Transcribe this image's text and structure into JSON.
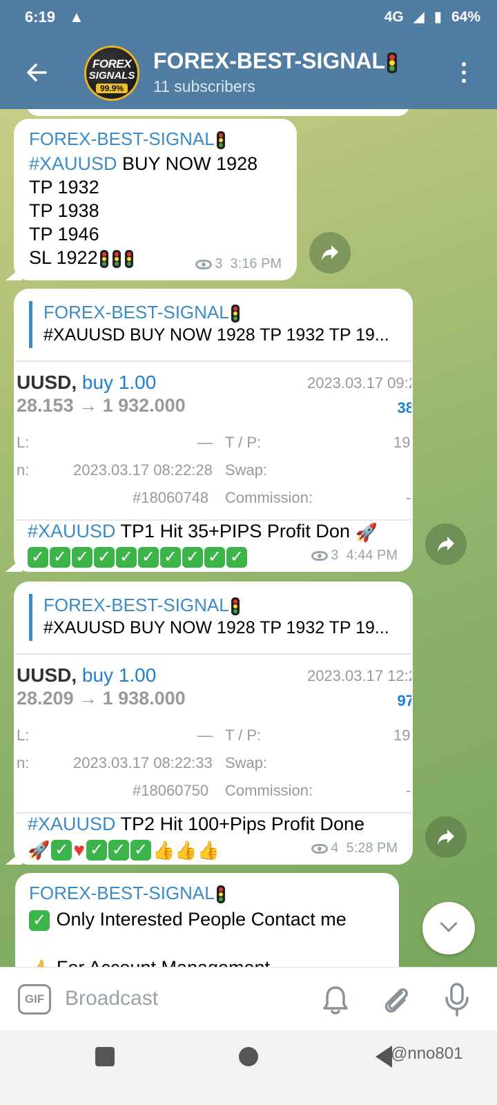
{
  "status_bar": {
    "time": "6:19",
    "warning": "▲",
    "network": "4G",
    "battery": "64%"
  },
  "header": {
    "back_icon": "arrow-left-icon",
    "avatar": {
      "line1": "FOREX",
      "line2": "SIGNALS",
      "line3": "99.9%"
    },
    "title": "FOREX-BEST-SIGNAL",
    "subtitle": "11 subscribers"
  },
  "messages": [
    {
      "sender": "FOREX-BEST-SIGNAL",
      "hashtag": "#XAUUSD",
      "line1_rest": " BUY NOW 1928",
      "line2": "TP 1932",
      "line3": "TP 1938",
      "line4": "TP 1946",
      "line5": "SL 1922",
      "views": "3",
      "time": "3:16 PM"
    },
    {
      "reply_sender": "FOREX-BEST-SIGNAL",
      "reply_text": "#XAUUSD BUY NOW 1928  TP 1932 TP 19...",
      "screenshot": {
        "symbol": "UUSD,",
        "side": "buy 1.00",
        "time": "2023.03.17 09:2",
        "prices": "28.153 → 1 932.000",
        "profit": "38",
        "sl_label": "L:",
        "sl_value": "—",
        "tp_label": "T / P:",
        "tp_value": "19",
        "open_label": "n:",
        "open_time": "2023.03.17 08:22:28",
        "swap_label": "Swap:",
        "ticket": "#18060748",
        "commission_label": "Commission:",
        "commission_value": "-"
      },
      "hashtag": "#XAUUSD",
      "text_rest": " TP1 Hit 35+PIPS Profit Don",
      "views": "3",
      "time": "4:44 PM"
    },
    {
      "reply_sender": "FOREX-BEST-SIGNAL",
      "reply_text": "#XAUUSD BUY NOW 1928  TP 1932 TP 19...",
      "screenshot": {
        "symbol": "UUSD,",
        "side": "buy 1.00",
        "time": "2023.03.17 12:2",
        "prices": "28.209 → 1 938.000",
        "profit": "97",
        "sl_label": "L:",
        "sl_value": "—",
        "tp_label": "T / P:",
        "tp_value": "19",
        "open_label": "n:",
        "open_time": "2023.03.17 08:22:33",
        "swap_label": "Swap:",
        "ticket": "#18060750",
        "commission_label": "Commission:",
        "commission_value": "-"
      },
      "hashtag": "#XAUUSD",
      "text_rest": " TP2 Hit 100+Pips Profit Done",
      "views": "4",
      "time": "5:28 PM"
    },
    {
      "sender": "FOREX-BEST-SIGNAL",
      "line1": "Only Interested People Contact me",
      "line2": "For Account Management"
    }
  ],
  "input_bar": {
    "gif_label": "GIF",
    "placeholder": "Broadcast"
  },
  "nav_bar": {
    "watermark": "@nno801"
  },
  "colors": {
    "header": "#517da2",
    "link": "#3a8bc8",
    "check": "#3cb44a"
  }
}
